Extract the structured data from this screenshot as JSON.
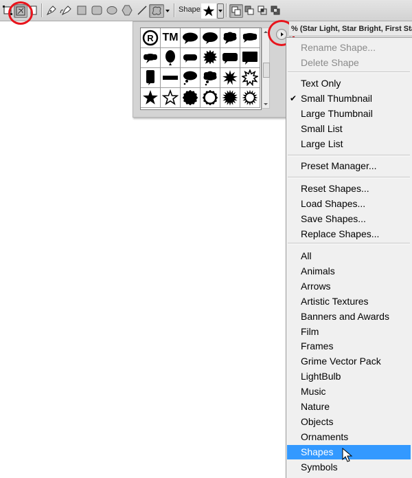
{
  "toolbar": {
    "tools": [
      {
        "name": "shape-layers-mode"
      },
      {
        "name": "paths-mode",
        "pressed": true
      },
      {
        "name": "fill-pixels-mode"
      },
      {
        "name": "pen-tool"
      },
      {
        "name": "freeform-pen-tool"
      },
      {
        "name": "rectangle-tool"
      },
      {
        "name": "rounded-rectangle-tool"
      },
      {
        "name": "ellipse-tool"
      },
      {
        "name": "polygon-tool"
      },
      {
        "name": "line-tool"
      },
      {
        "name": "custom-shape-tool",
        "pressed": true
      }
    ],
    "shape_label": "Shape:",
    "shape_icon": "star-icon",
    "combine_modes": [
      "add-to-shape-area",
      "subtract-from-shape-area",
      "intersect-shape-areas",
      "exclude-overlapping-shape-areas"
    ]
  },
  "picker": {
    "shapes": [
      "registered-trademark",
      "trademark",
      "speech-bubble-1",
      "speech-bubble-2",
      "speech-bubble-3",
      "speech-bubble-4",
      "speech-bubble-5",
      "balloon",
      "speech-bubble-6",
      "speech-bubble-7",
      "speech-bubble-8",
      "speech-bubble-9",
      "speech-bubble-10",
      "banner-bar",
      "thought-bubble-1",
      "thought-bubble-2",
      "starburst-1",
      "starburst-outline-1",
      "star-filled",
      "star-outline",
      "seal-filled",
      "seal-outline",
      "starburst-2",
      "starburst-outline-2"
    ],
    "registered_text": "®",
    "tm_text": "TM"
  },
  "title_strip": "% (Star Light, Star Bright, First Star",
  "menu": {
    "groups": [
      [
        {
          "label": "Rename Shape...",
          "disabled": true
        },
        {
          "label": "Delete Shape",
          "disabled": true
        }
      ],
      [
        {
          "label": "Text Only"
        },
        {
          "label": "Small Thumbnail",
          "checked": true
        },
        {
          "label": "Large Thumbnail"
        },
        {
          "label": "Small List"
        },
        {
          "label": "Large List"
        }
      ],
      [
        {
          "label": "Preset Manager..."
        }
      ],
      [
        {
          "label": "Reset Shapes..."
        },
        {
          "label": "Load Shapes..."
        },
        {
          "label": "Save Shapes..."
        },
        {
          "label": "Replace Shapes..."
        }
      ],
      [
        {
          "label": "All"
        },
        {
          "label": "Animals"
        },
        {
          "label": "Arrows"
        },
        {
          "label": "Artistic Textures"
        },
        {
          "label": "Banners and Awards"
        },
        {
          "label": "Film"
        },
        {
          "label": "Frames"
        },
        {
          "label": "Grime Vector Pack"
        },
        {
          "label": "LightBulb"
        },
        {
          "label": "Music"
        },
        {
          "label": "Nature"
        },
        {
          "label": "Objects"
        },
        {
          "label": "Ornaments"
        },
        {
          "label": "Shapes",
          "highlighted": true
        },
        {
          "label": "Symbols"
        }
      ]
    ],
    "check_glyph": "✔",
    "highlight_color": "#3399ff"
  },
  "annotations": {
    "circle_color": "#e8141c"
  }
}
